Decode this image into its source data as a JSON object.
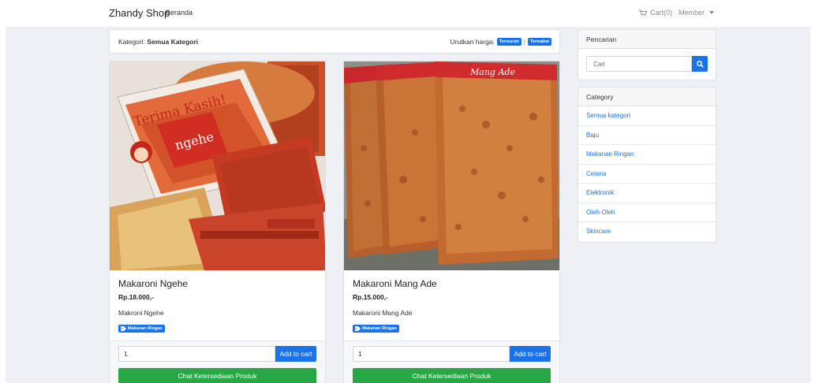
{
  "navbar": {
    "brand": "Zhandy Shop",
    "home": "Beranda",
    "cart": "Cart(0)",
    "member": "Member"
  },
  "sortbar": {
    "category_label": "Kategori:",
    "category_value": "Semua Kategori",
    "sort_label": "Urutkan harga:",
    "sort_cheapest": "Termurah",
    "sort_separator": "|",
    "sort_expensive": "Termahal"
  },
  "products": [
    {
      "title": "Makaroni Ngehe",
      "price": "Rp.18.000,-",
      "description": "Makroni Ngehe",
      "tag": "Makanan Ringan",
      "quantity": "1",
      "add_to_cart": "Add to cart",
      "chat": "Chat Ketersediaan Produk",
      "image_text": "Terima Kasih!",
      "image_brand": "ngehe"
    },
    {
      "title": "Makaroni Mang Ade",
      "price": "Rp.15.000,-",
      "description": "Makaroni Mang Ade",
      "tag": "Makanan Ringan",
      "quantity": "1",
      "add_to_cart": "Add to cart",
      "chat": "Chat Ketersediaan Produk",
      "image_brand": "Mang Ade"
    }
  ],
  "search": {
    "heading": "Pencarian",
    "placeholder": "Cari"
  },
  "category": {
    "heading": "Category",
    "items": [
      "Semua kategori",
      "Baju",
      "Makanan Ringan",
      "Celana",
      "Elektronik",
      "Oleh-Oleh",
      "Skincare"
    ]
  },
  "colors": {
    "primary": "#1a73e8",
    "success": "#28a745",
    "background": "#eef0f5"
  },
  "icons": {
    "cart": "cart-icon",
    "search": "search-icon",
    "tag": "tag-icon",
    "caret": "caret-down-icon"
  }
}
